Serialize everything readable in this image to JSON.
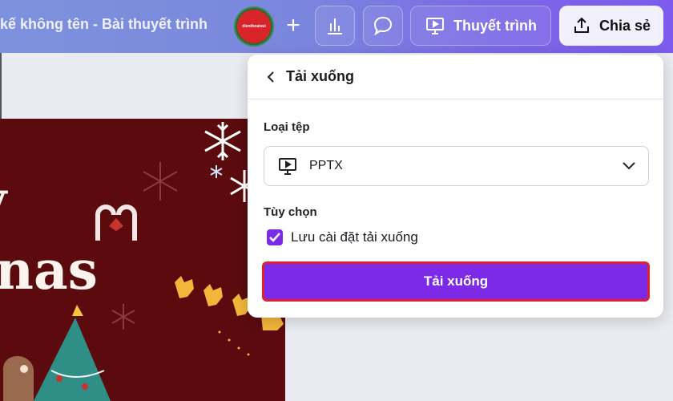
{
  "topbar": {
    "doc_title": "kế không tên - Bài thuyết trình",
    "avatar_text": "dienthoaivui",
    "plus_label": "+",
    "present_label": "Thuyết trình",
    "share_label": "Chia sẻ"
  },
  "slide": {
    "line1": "y",
    "line2": "nas"
  },
  "download_panel": {
    "title": "Tải xuống",
    "file_type_label": "Loại tệp",
    "file_type_value": "PPTX",
    "options_label": "Tùy chọn",
    "save_settings_label": "Lưu cài đặt tải xuống",
    "save_settings_checked": true,
    "download_button": "Tải xuống"
  },
  "colors": {
    "accent": "#7d2ae8",
    "highlight_border": "#e0202c",
    "slide_bg": "#5b0b0e"
  }
}
